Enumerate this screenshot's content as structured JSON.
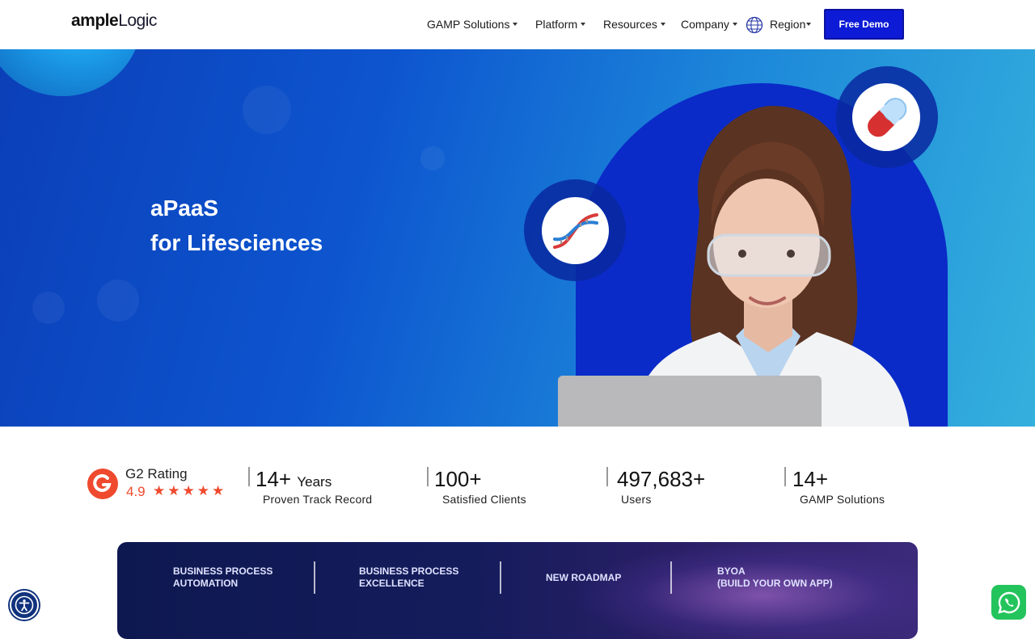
{
  "header": {
    "logo": {
      "part_a": "ample",
      "part_b": "Logic"
    },
    "nav": [
      {
        "label": "GAMP Solutions"
      },
      {
        "label": "Platform"
      },
      {
        "label": "Resources"
      },
      {
        "label": "Company"
      }
    ],
    "region_label": "Region",
    "demo_button": "Free Demo"
  },
  "hero": {
    "title_line1": "aPaaS",
    "title_line2": "for Lifesciences"
  },
  "stats": {
    "g2": {
      "label": "G2 Rating",
      "score": "4.9",
      "stars": "★★★★★",
      "rating": 5
    },
    "items": [
      {
        "number": "14+",
        "suffix": "Years",
        "label": "Proven Track Record"
      },
      {
        "number": "100+",
        "suffix": "",
        "label": "Satisfied Clients"
      },
      {
        "number": "497,683+",
        "suffix": "",
        "label": "Users"
      },
      {
        "number": "14+",
        "suffix": "",
        "label": "GAMP Solutions"
      }
    ]
  },
  "banner": {
    "items": [
      {
        "line1": "BUSINESS PROCESS",
        "line2": "AUTOMATION"
      },
      {
        "line1": "BUSINESS PROCESS",
        "line2": "EXCELLENCE"
      },
      {
        "line1": "NEW ROADMAP",
        "line2": ""
      },
      {
        "line1": "BYOA",
        "line2": "(BUILD YOUR OWN APP)"
      }
    ]
  },
  "icons": {
    "accessibility": "accessibility-icon",
    "whatsapp": "whatsapp-icon",
    "globe": "globe-icon",
    "dna": "dna-icon",
    "capsule": "capsule-icon"
  },
  "colors": {
    "primary": "#0d1ad6",
    "rating": "#ef4a2e",
    "whatsapp": "#24c45c"
  }
}
